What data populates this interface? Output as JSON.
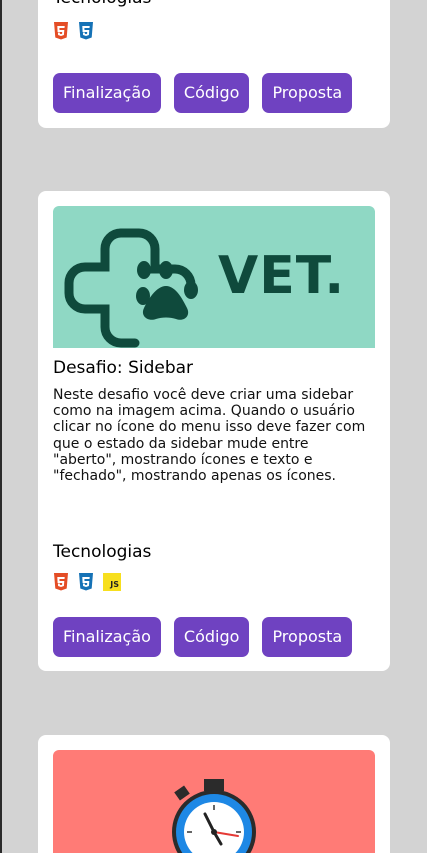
{
  "card_top": {
    "tech_title": "Tecnologias",
    "technologies": [
      "html5-icon",
      "css3-icon"
    ],
    "buttons": {
      "finalizacao": "Finalização",
      "codigo": "Código",
      "proposta": "Proposta"
    }
  },
  "card_sidebar": {
    "banner_text": "VET.",
    "title": "Desafio: Sidebar",
    "description": "Neste desafio você deve criar uma sidebar como na imagem acima. Quando o usuário clicar no ícone do menu isso deve fazer com que o estado da sidebar mude entre \"aberto\", mostrando ícones e texto e \"fechado\", mostrando apenas os ícones.",
    "tech_title": "Tecnologias",
    "technologies": [
      "html5-icon",
      "css3-icon",
      "javascript-icon"
    ],
    "js_label": "JS",
    "buttons": {
      "finalizacao": "Finalização",
      "codigo": "Código",
      "proposta": "Proposta"
    }
  },
  "card_bottom": {
    "banner": "stopwatch-icon"
  },
  "colors": {
    "page_bg": "#d3d3d3",
    "card_bg": "#ffffff",
    "button_bg": "#6f42c1",
    "vet_banner_bg": "#8fd8c4",
    "vet_logo": "#0f4a3c",
    "clock_banner_bg": "#ff7b76"
  }
}
